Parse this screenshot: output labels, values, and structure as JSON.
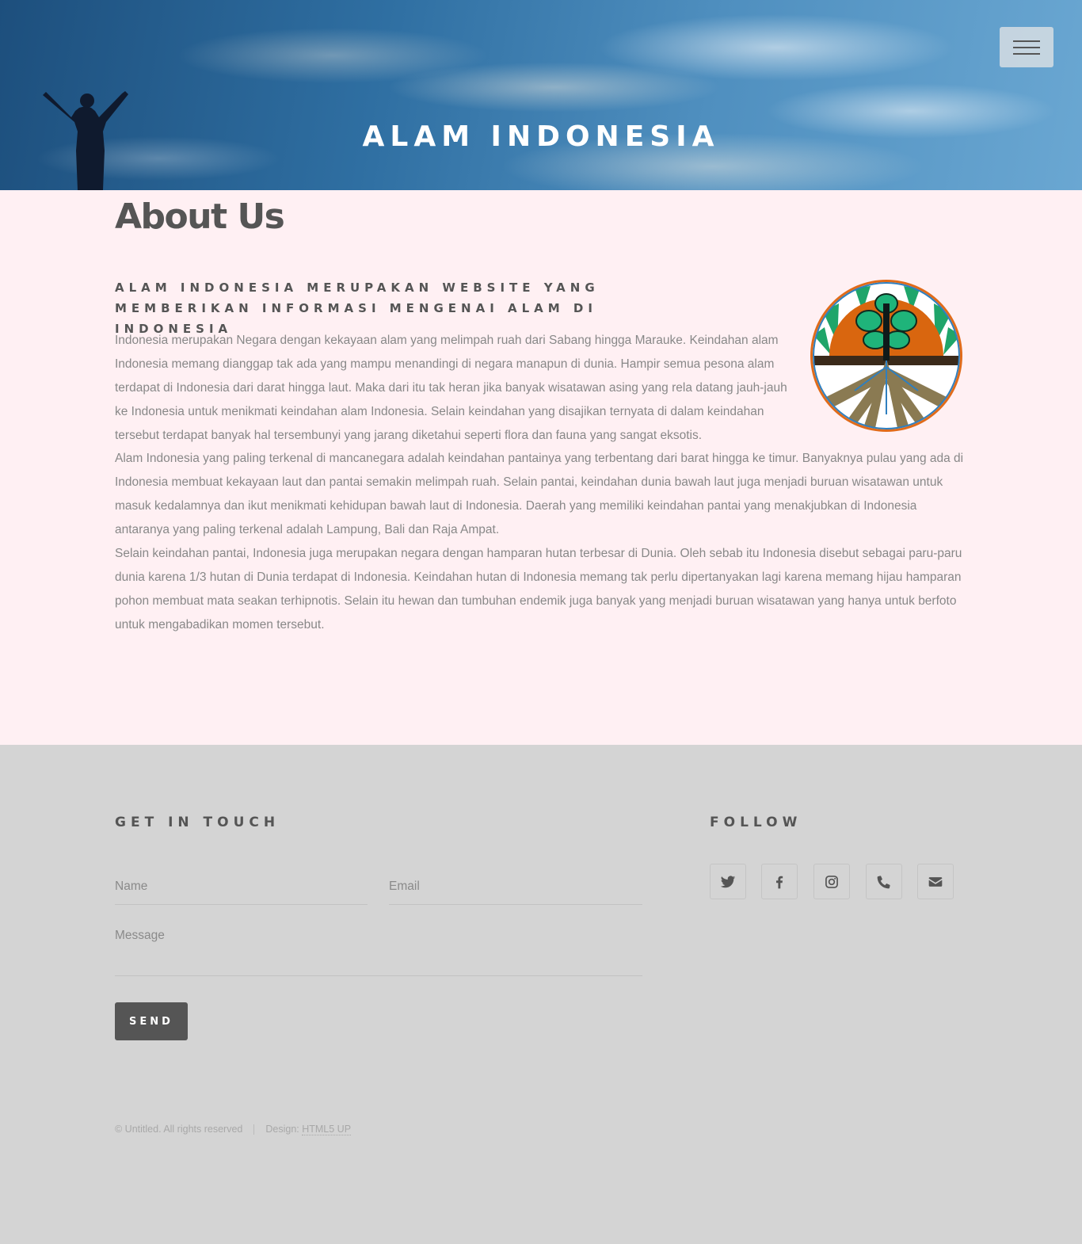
{
  "header": {
    "site_title": "ALAM INDONESIA",
    "menu_icon": "hamburger-menu-icon"
  },
  "about": {
    "page_title": "About Us",
    "subtitle": "ALAM INDONESIA MERUPAKAN WEBSITE YANG MEMBERIKAN INFORMASI MENGENAI ALAM DI INDONESIA",
    "paragraphs": [
      "Indonesia merupakan Negara dengan kekayaan alam yang melimpah ruah dari Sabang hingga Marauke. Keindahan alam Indonesia memang dianggap tak ada yang mampu menandingi di negara manapun di dunia. Hampir semua pesona alam terdapat di Indonesia dari darat hingga laut. Maka dari itu tak heran jika banyak wisatawan asing yang rela datang jauh-jauh ke Indonesia untuk menikmati keindahan alam Indonesia. Selain keindahan yang disajikan ternyata di dalam keindahan tersebut terdapat banyak hal tersembunyi yang jarang diketahui seperti flora dan fauna yang sangat eksotis.",
      "Alam Indonesia yang paling terkenal di mancanegara adalah keindahan pantainya yang terbentang dari barat hingga ke timur. Banyaknya pulau yang ada di Indonesia membuat kekayaan laut dan pantai semakin melimpah ruah. Selain pantai, keindahan dunia bawah laut juga menjadi buruan wisatawan untuk masuk kedalamnya dan ikut menikmati kehidupan bawah laut di Indonesia. Daerah yang memiliki keindahan pantai yang menakjubkan di Indonesia antaranya yang paling terkenal adalah Lampung, Bali dan Raja Ampat.",
      "Selain keindahan pantai, Indonesia juga merupakan negara dengan hamparan hutan terbesar di Dunia. Oleh sebab itu Indonesia disebut sebagai paru-paru dunia karena 1/3 hutan di Dunia terdapat di Indonesia. Keindahan hutan di Indonesia memang tak perlu dipertanyakan lagi karena memang hijau hamparan pohon membuat mata seakan terhipnotis. Selain itu hewan dan tumbuhan endemik juga banyak yang menjadi buruan wisatawan yang hanya untuk berfoto untuk mengabadikan momen tersebut."
    ]
  },
  "footer": {
    "contact_heading": "GET IN TOUCH",
    "name_placeholder": "Name",
    "email_placeholder": "Email",
    "message_placeholder": "Message",
    "send_label": "SEND",
    "follow_heading": "FOLLOW",
    "social_icons": [
      "twitter-icon",
      "facebook-icon",
      "instagram-icon",
      "phone-icon",
      "envelope-icon"
    ],
    "copyright": "© Untitled. All rights reserved",
    "design_label": "Design:",
    "design_link": "HTML5 UP"
  },
  "colors": {
    "main_bg": "#fff0f3",
    "footer_bg": "#d4d4d4",
    "text_dark": "#555555",
    "text_body": "#888888",
    "button_bg": "#555555"
  }
}
